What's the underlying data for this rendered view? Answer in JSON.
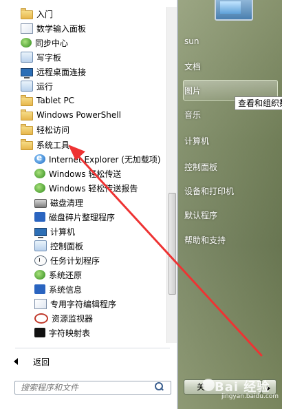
{
  "programs": [
    {
      "label": "入门",
      "icon": "folder-icon"
    },
    {
      "label": "数学输入面板",
      "icon": "pen-icon"
    },
    {
      "label": "同步中心",
      "icon": "sync-icon"
    },
    {
      "label": "写字板",
      "icon": "wordpad-icon"
    },
    {
      "label": "远程桌面连接",
      "icon": "remote-desktop-icon"
    },
    {
      "label": "运行",
      "icon": "run-icon"
    },
    {
      "label": "Tablet PC",
      "icon": "folder-icon"
    },
    {
      "label": "Windows PowerShell",
      "icon": "folder-icon"
    },
    {
      "label": "轻松访问",
      "icon": "folder-icon"
    },
    {
      "label": "系统工具",
      "icon": "folder-icon"
    }
  ],
  "system_tools": [
    {
      "label": "Internet Explorer (无加载项)",
      "icon": "ie-icon"
    },
    {
      "label": "Windows 轻松传送",
      "icon": "transfer-icon"
    },
    {
      "label": "Windows 轻松传送报告",
      "icon": "transfer-report-icon"
    },
    {
      "label": "磁盘清理",
      "icon": "disk-cleanup-icon"
    },
    {
      "label": "磁盘碎片整理程序",
      "icon": "defrag-icon"
    },
    {
      "label": "计算机",
      "icon": "computer-icon"
    },
    {
      "label": "控制面板",
      "icon": "control-panel-icon"
    },
    {
      "label": "任务计划程序",
      "icon": "clock-icon"
    },
    {
      "label": "系统还原",
      "icon": "restore-icon"
    },
    {
      "label": "系统信息",
      "icon": "info-icon"
    },
    {
      "label": "专用字符编辑程序",
      "icon": "char-editor-icon"
    },
    {
      "label": "资源监视器",
      "icon": "resource-monitor-icon"
    },
    {
      "label": "字符映射表",
      "icon": "char-map-icon"
    }
  ],
  "back_label": "返回",
  "search_placeholder": "搜索程序和文件",
  "right_menu": [
    {
      "label": "sun"
    },
    {
      "label": "文档"
    },
    {
      "label": "图片"
    },
    {
      "label": "音乐"
    },
    {
      "label": "计算机"
    },
    {
      "label": "控制面板"
    },
    {
      "label": "设备和打印机"
    },
    {
      "label": "默认程序"
    },
    {
      "label": "帮助和支持"
    }
  ],
  "tooltip": "查看和组织数",
  "shutdown_label": "关",
  "watermark": {
    "title": "Bai 经验",
    "url": "jingyan.baidu.com"
  }
}
